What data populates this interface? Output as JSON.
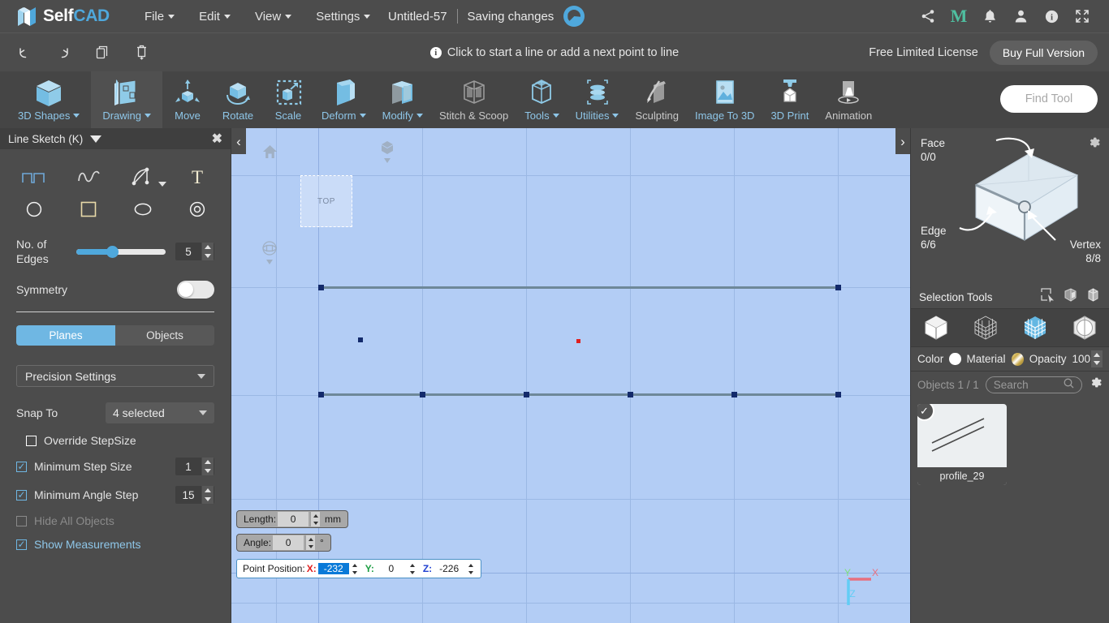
{
  "app": {
    "logo_self": "Self",
    "logo_cad": "CAD",
    "logo_icon": "selfcad-logo-icon"
  },
  "menubar": {
    "items": [
      {
        "label": "File",
        "caret": true
      },
      {
        "label": "Edit",
        "caret": true
      },
      {
        "label": "View",
        "caret": true
      },
      {
        "label": "Settings",
        "caret": true
      }
    ],
    "document_title": "Untitled-57",
    "save_status": "Saving changes",
    "spinner_icon": "saving-spinner-icon",
    "right_icons": [
      {
        "name": "share-icon",
        "glyph": "share"
      },
      {
        "name": "mentor-m-icon",
        "glyph": "M"
      },
      {
        "name": "notifications-bell-icon",
        "glyph": "bell"
      },
      {
        "name": "user-account-icon",
        "glyph": "person"
      },
      {
        "name": "info-icon",
        "glyph": "info"
      },
      {
        "name": "fullscreen-icon",
        "glyph": "expand"
      }
    ]
  },
  "toolbar2": {
    "buttons": [
      {
        "name": "undo-button",
        "glyph": "undo"
      },
      {
        "name": "redo-button",
        "glyph": "redo"
      },
      {
        "name": "copy-button",
        "glyph": "copy"
      },
      {
        "name": "delete-button",
        "glyph": "trash"
      }
    ],
    "hint": "Click to start a line or add a next point to line",
    "hint_icon": "info-icon",
    "license_text": "Free Limited License",
    "buy_label": "Buy Full Version"
  },
  "ribbon": {
    "items": [
      {
        "label": "3D Shapes",
        "icon": "cube-icon",
        "caret": true,
        "active": false,
        "gray": false
      },
      {
        "label": "Drawing",
        "icon": "drawing-icon",
        "caret": true,
        "active": true,
        "gray": false
      },
      {
        "label": "Move",
        "icon": "move-icon",
        "caret": false,
        "active": false,
        "gray": false
      },
      {
        "label": "Rotate",
        "icon": "rotate-icon",
        "caret": false,
        "active": false,
        "gray": false
      },
      {
        "label": "Scale",
        "icon": "scale-icon",
        "caret": false,
        "active": false,
        "gray": false
      },
      {
        "label": "Deform",
        "icon": "deform-icon",
        "caret": true,
        "active": false,
        "gray": false
      },
      {
        "label": "Modify",
        "icon": "modify-icon",
        "caret": true,
        "active": false,
        "gray": false
      },
      {
        "label": "Stitch & Scoop",
        "icon": "stitch-scoop-icon",
        "caret": false,
        "active": false,
        "gray": true
      },
      {
        "label": "Tools",
        "icon": "tools-icon",
        "caret": true,
        "active": false,
        "gray": false
      },
      {
        "label": "Utilities",
        "icon": "utilities-icon",
        "caret": true,
        "active": false,
        "gray": false
      },
      {
        "label": "Sculpting",
        "icon": "sculpting-icon",
        "caret": false,
        "active": false,
        "gray": true
      },
      {
        "label": "Image To 3D",
        "icon": "image-to-3d-icon",
        "caret": false,
        "active": false,
        "gray": false
      },
      {
        "label": "3D Print",
        "icon": "3d-print-icon",
        "caret": false,
        "active": false,
        "gray": false
      },
      {
        "label": "Animation",
        "icon": "animation-icon",
        "caret": false,
        "active": false,
        "gray": true
      }
    ],
    "find_tool_placeholder": "Find Tool"
  },
  "left_panel": {
    "title": "Line Sketch (K)",
    "collapse_icon": "triangle-down-icon",
    "close_icon": "close-icon",
    "shape_tools": [
      {
        "name": "polyline-icon"
      },
      {
        "name": "freehand-curve-icon"
      },
      {
        "name": "bezier-curve-icon",
        "caret": true
      },
      {
        "name": "text-tool-icon"
      },
      {
        "name": "circle-icon"
      },
      {
        "name": "square-icon"
      },
      {
        "name": "ellipse-icon"
      },
      {
        "name": "concentric-circle-icon"
      }
    ],
    "edges_label": "No. of Edges",
    "edges_value": "5",
    "symmetry_label": "Symmetry",
    "symmetry_on": false,
    "segments": [
      {
        "label": "Planes",
        "active": true
      },
      {
        "label": "Objects",
        "active": false
      }
    ],
    "precision_settings_label": "Precision Settings",
    "snap_to_label": "Snap To",
    "snap_to_value": "4 selected",
    "checkboxes": [
      {
        "label": "Override StepSize",
        "checked": false,
        "disabled": false,
        "value": null
      },
      {
        "label": "Minimum Step Size",
        "checked": true,
        "disabled": false,
        "value": "1"
      },
      {
        "label": "Minimum Angle Step",
        "checked": true,
        "disabled": false,
        "value": "15"
      },
      {
        "label": "Hide All Objects",
        "checked": false,
        "disabled": true,
        "value": null
      },
      {
        "label": "Show Measurements",
        "checked": true,
        "disabled": false,
        "value": null
      }
    ]
  },
  "viewport": {
    "plane_label": "TOP",
    "home_icon": "home-icon",
    "view-cube_icon": "view-cube-icon",
    "orbit_icon": "orbit-gizmo-icon",
    "collapse_left_icon": "chevron-left-icon",
    "collapse_right_icon": "chevron-right-icon",
    "axis": {
      "x": "X",
      "y": "Y",
      "z": "Z"
    },
    "measurements": {
      "length_label": "Length:",
      "length_value": "0",
      "length_unit": "mm",
      "angle_label": "Angle:",
      "angle_value": "0",
      "angle_unit": "°",
      "point_position_label": "Point Position:",
      "x_label": "X:",
      "x_value": "-232",
      "y_label": "Y:",
      "y_value": "0",
      "z_label": "Z:",
      "z_value": "-226"
    }
  },
  "right_panel": {
    "face_label": "Face",
    "face_value": "0/0",
    "edge_label": "Edge",
    "edge_value": "6/6",
    "vertex_label": "Vertex",
    "vertex_value": "8/8",
    "settings_icon": "gear-icon",
    "selection_tools_label": "Selection Tools",
    "selection_tool_icons": [
      {
        "name": "rectangle-select-icon"
      },
      {
        "name": "box-select-icon"
      },
      {
        "name": "lasso-select-icon"
      }
    ],
    "mode_icons": [
      {
        "name": "object-mode-icon"
      },
      {
        "name": "wireframe-mode-icon"
      },
      {
        "name": "face-mode-icon"
      },
      {
        "name": "vertex-mode-icon"
      }
    ],
    "color_label": "Color",
    "material_label": "Material",
    "opacity_label": "Opacity",
    "opacity_value": "100",
    "objects_count_label": "Objects 1 / 1",
    "search_placeholder": "Search",
    "search_icon": "search-icon",
    "objects_settings_icon": "gear-icon",
    "objects": [
      {
        "name": "profile_29",
        "selected": true,
        "thumbnail": "two-diagonal-lines"
      }
    ]
  },
  "colors": {
    "accent_blue": "#4fa8dc",
    "panel_bg": "#4c4c4c",
    "ribbon_bg": "#454545",
    "viewport_bg": "#b3cdf5",
    "label_blue": "#8ec6e8"
  }
}
